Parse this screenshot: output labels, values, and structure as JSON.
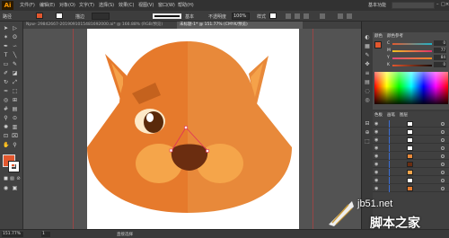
{
  "app": {
    "logo": "Ai"
  },
  "menu": {
    "items": [
      "文件(F)",
      "编辑(E)",
      "对象(O)",
      "文字(T)",
      "选择(S)",
      "效果(C)",
      "视图(V)",
      "窗口(W)",
      "帮助(H)"
    ],
    "workspace": "基本功能"
  },
  "control": {
    "selection_label": "路径",
    "stroke_label": "描边",
    "brush_label": "基本",
    "opacity_label": "不透明度",
    "opacity_value": "100%",
    "style_label": "样式"
  },
  "tabs": [
    {
      "label": "Npw- 29842667-2019091015481692000.ai* @ 166.88% (RGB/预览)",
      "active": false
    },
    {
      "label": "未标题-1* @ 151.77% (CMYK/预览)",
      "active": true
    }
  ],
  "colors": {
    "fill": "#e2572e",
    "face_left": "#e67a2c",
    "face_right": "#e8893a",
    "ear_inner": "#f5a24a",
    "cheek": "#f5a54a",
    "nose": "#6b2d10",
    "eye": "#5a2a0a",
    "eyebrow": "#c4621e",
    "selection": "#e0305a"
  },
  "color_panel": {
    "tabs": [
      "颜色",
      "颜色参考"
    ],
    "sliders": [
      {
        "label": "C",
        "value": "0"
      },
      {
        "label": "M",
        "value": "77"
      },
      {
        "label": "Y",
        "value": "84"
      },
      {
        "label": "K",
        "value": "0"
      }
    ]
  },
  "layers_panel": {
    "tabs": [
      "色板",
      "画笔",
      "图层"
    ],
    "rows": 9
  },
  "status": {
    "zoom": "151.77%",
    "page": "1",
    "tool": "直接选择"
  },
  "watermark": {
    "site": "jb51.net",
    "name": "脚本之家"
  }
}
